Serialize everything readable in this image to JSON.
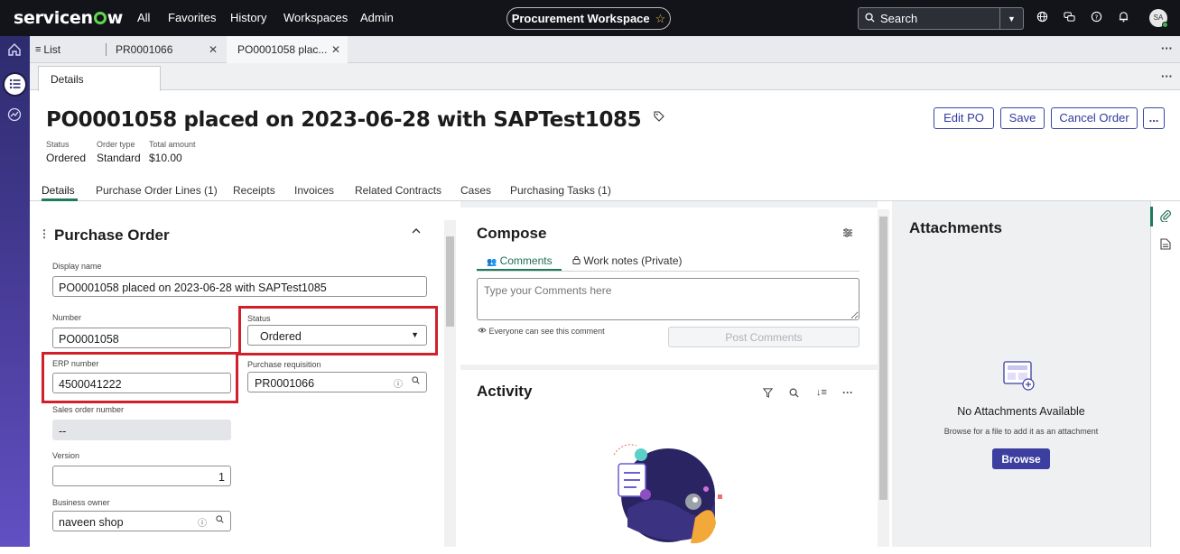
{
  "topbar": {
    "logo": "servicenow",
    "nav": [
      "All",
      "Favorites",
      "History",
      "Workspaces",
      "Admin"
    ],
    "workspace_pill": "Procurement Workspace",
    "search_placeholder": "Search",
    "avatar_initials": "SA"
  },
  "workspace_tabs": [
    {
      "label": "List"
    },
    {
      "label": "PR0001066"
    },
    {
      "label": "PO0001058 plac..."
    }
  ],
  "sub_tab": "Details",
  "record": {
    "title": "PO0001058 placed on 2023-06-28 with SAPTest1085",
    "actions": [
      "Edit PO",
      "Save",
      "Cancel Order",
      "..."
    ],
    "meta": [
      {
        "label": "Status",
        "value": "Ordered"
      },
      {
        "label": "Order type",
        "value": "Standard"
      },
      {
        "label": "Total amount",
        "value": "$10.00"
      }
    ]
  },
  "related_tabs": [
    "Details",
    "Purchase Order Lines (1)",
    "Receipts",
    "Invoices",
    "Related Contracts",
    "Cases",
    "Purchasing Tasks (1)"
  ],
  "form": {
    "section_title": "Purchase Order",
    "display_name_label": "Display name",
    "display_name_value": "PO0001058 placed on 2023-06-28 with SAPTest1085",
    "number_label": "Number",
    "number_value": "PO0001058",
    "status_label": "Status",
    "status_value": "Ordered",
    "erp_label": "ERP number",
    "erp_value": "4500041222",
    "purchase_req_label": "Purchase requisition",
    "purchase_req_value": "PR0001066",
    "sales_order_label": "Sales order number",
    "sales_order_value": "--",
    "version_label": "Version",
    "version_value": "1",
    "business_owner_label": "Business owner",
    "business_owner_value": "naveen shop"
  },
  "compose": {
    "title": "Compose",
    "tab_comments": "Comments",
    "tab_worknotes": "Work notes (Private)",
    "placeholder": "Type your Comments here",
    "visibility_note": "Everyone can see this comment",
    "post_label": "Post Comments"
  },
  "activity": {
    "title": "Activity"
  },
  "attachments": {
    "title": "Attachments",
    "empty_title": "No Attachments Available",
    "empty_sub": "Browse for a file to add it as an attachment",
    "browse_label": "Browse"
  },
  "colors": {
    "topbar": "#13131a",
    "accent": "#3c47a8",
    "highlight": "#d0202b",
    "browse": "#3c3fa0"
  }
}
